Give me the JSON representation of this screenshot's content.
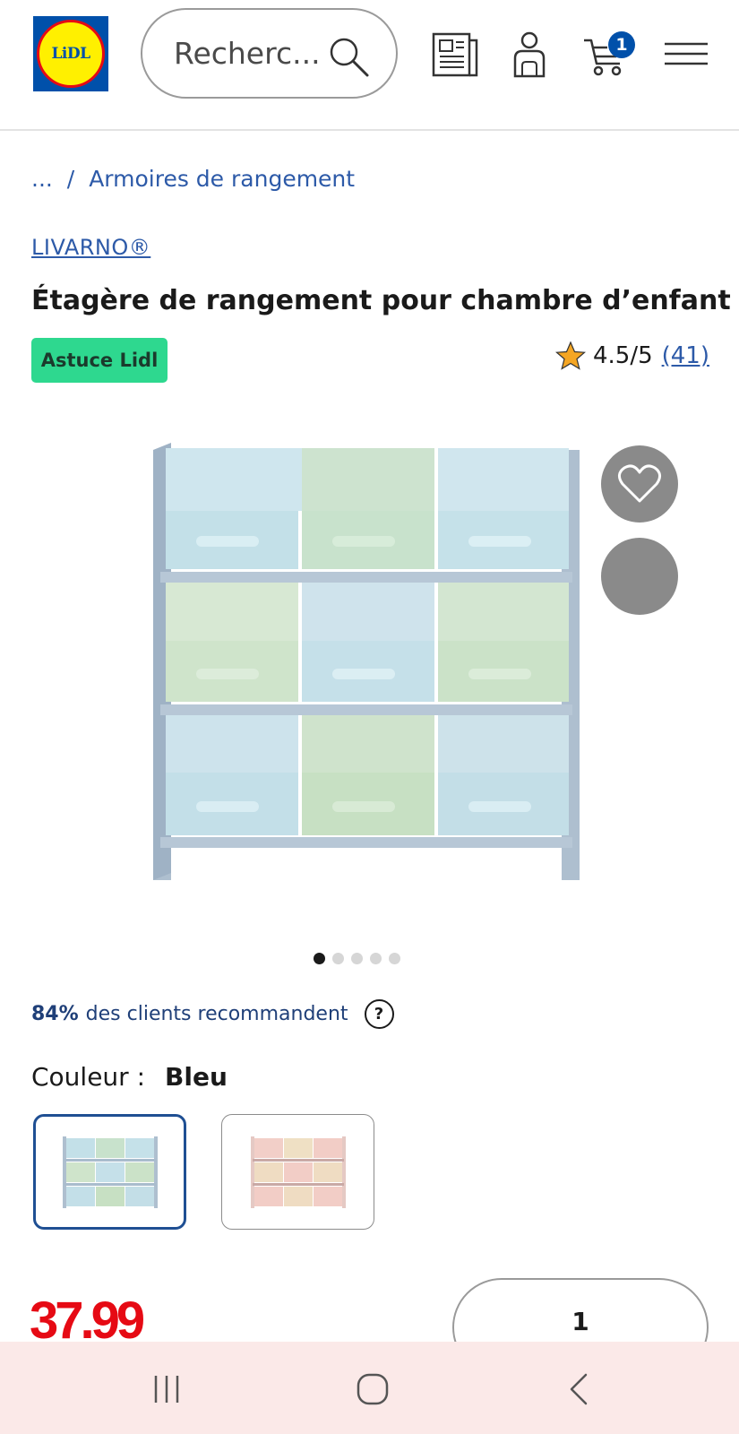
{
  "header": {
    "logo_text": "LiDL",
    "search_placeholder": "Recherc...",
    "cart_count": "1"
  },
  "breadcrumb": {
    "ellipsis": "...",
    "separator": "/",
    "current": "Armoires de rangement"
  },
  "product": {
    "brand": "LIVARNO®",
    "title": "Étagère de rangement pour chambre d’enfant",
    "badge": "Astuce Lidl",
    "rating": "4.5/5",
    "review_count": "(41)",
    "gallery": {
      "slides": 5,
      "active_slide": 1
    },
    "recommend_percent": "84%",
    "recommend_text": "des clients recommandent",
    "help_symbol": "?",
    "colour_label": "Couleur :",
    "colour_value": "Bleu",
    "price": "37.99",
    "quantity": "1"
  },
  "colors": {
    "brand_blue": "#0050aa",
    "lidl_yellow": "#fff000",
    "lidl_red": "#e60a14",
    "badge_green": "#2ed88f",
    "link_blue": "#2d5aa8",
    "star": "#f5a623"
  },
  "icons": [
    "search-icon",
    "flyer-icon",
    "account-icon",
    "cart-icon",
    "menu-icon",
    "star-icon",
    "heart-icon",
    "recents-icon",
    "home-icon",
    "back-icon"
  ]
}
